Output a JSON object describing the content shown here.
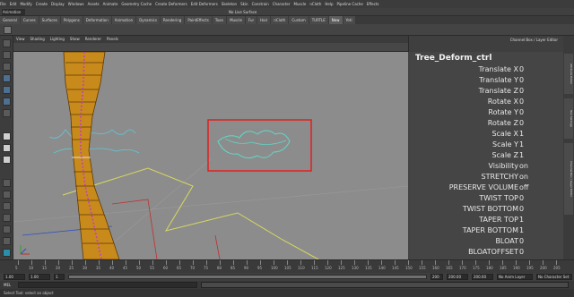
{
  "menu": [
    "File",
    "Edit",
    "Modify",
    "Create",
    "Display",
    "Windows",
    "Assets",
    "Animate",
    "Geometry Cache",
    "Create Deformers",
    "Edit Deformers",
    "Skeleton",
    "Skin",
    "Constrain",
    "Character",
    "Muscle",
    "nCloth",
    "Help",
    "Pipeline Cache",
    "Effects"
  ],
  "status": {
    "mode": "Animation",
    "live_surface": "No Live Surface"
  },
  "shelf_tabs": [
    "General",
    "Curves",
    "Surfaces",
    "Polygons",
    "Deformation",
    "Animation",
    "Dynamics",
    "Rendering",
    "PaintEffects",
    "Toon",
    "Muscle",
    "Fur",
    "Hair",
    "nCloth",
    "Custom",
    "TURTLE",
    "New",
    "Yeti"
  ],
  "shelf_active_index": 16,
  "panel_menu": [
    "View",
    "Shading",
    "Lighting",
    "Show",
    "Renderer",
    "Panels"
  ],
  "channel_box": {
    "header": "Channel Box / Layer Editor",
    "title": "Tree_Deform_ctrl",
    "attributes": [
      {
        "label": "Translate X",
        "value": "0"
      },
      {
        "label": "Translate Y",
        "value": "0"
      },
      {
        "label": "Translate Z",
        "value": "0"
      },
      {
        "label": "Rotate X",
        "value": "0"
      },
      {
        "label": "Rotate Y",
        "value": "0"
      },
      {
        "label": "Rotate Z",
        "value": "0"
      },
      {
        "label": "Scale X",
        "value": "1"
      },
      {
        "label": "Scale Y",
        "value": "1"
      },
      {
        "label": "Scale Z",
        "value": "1"
      },
      {
        "label": "Visibility",
        "value": "on"
      },
      {
        "label": "STRETCHY",
        "value": "on"
      },
      {
        "label": "PRESERVE VOLUME",
        "value": "off"
      },
      {
        "label": "TWIST TOP",
        "value": "0"
      },
      {
        "label": "TWIST BOTTOM",
        "value": "0"
      },
      {
        "label": "TAPER TOP",
        "value": "1"
      },
      {
        "label": "TAPER BOTTOM",
        "value": "1"
      },
      {
        "label": "BLOAT",
        "value": "0"
      },
      {
        "label": "BLOATOFFSET",
        "value": "0"
      }
    ]
  },
  "side_tabs": [
    "Attribute Editor",
    "Tool Settings",
    "Channel Box / Layer Editor"
  ],
  "timeline": {
    "ticks": [
      "5",
      "10",
      "15",
      "20",
      "25",
      "30",
      "35",
      "40",
      "45",
      "50",
      "55",
      "60",
      "65",
      "70",
      "75",
      "80",
      "85",
      "90",
      "95",
      "100",
      "105",
      "110",
      "115",
      "120",
      "125",
      "130",
      "135",
      "140",
      "145",
      "150",
      "155",
      "160",
      "165",
      "170",
      "175",
      "180",
      "185",
      "190",
      "195",
      "200",
      "205"
    ]
  },
  "range": {
    "start": "1.00",
    "start_inner": "1.00",
    "frame": "1",
    "end_inner": "200",
    "end": "200.00",
    "end2": "200.00",
    "anim_layer": "No Anim Layer",
    "char_set": "No Character Set"
  },
  "cmd": {
    "mel": "MEL"
  },
  "help_line": "Select Tool: select an object",
  "colors": {
    "viewport": "#8c8c8c",
    "trunk": "#c98a1c",
    "joint": "#c040c0",
    "selection_box": "#e11f1f",
    "ctrl_curve": "#60d8c8",
    "yellow_curve": "#d8d860"
  }
}
